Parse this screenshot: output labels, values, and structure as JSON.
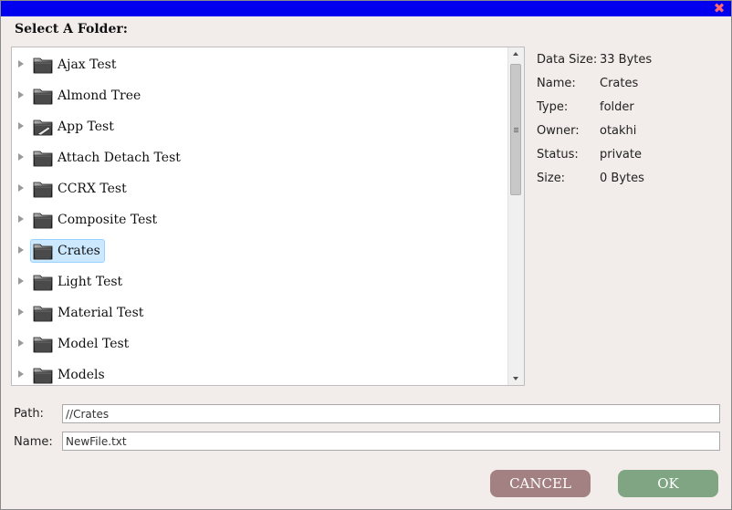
{
  "dialog": {
    "close_glyph": "✖",
    "heading": "Select A Folder:"
  },
  "tree": {
    "items": [
      {
        "label": "Ajax Test",
        "icon": "folder-icon",
        "selected": false
      },
      {
        "label": "Almond Tree",
        "icon": "folder-icon",
        "selected": false
      },
      {
        "label": "App Test",
        "icon": "app-folder-icon",
        "selected": false
      },
      {
        "label": "Attach Detach Test",
        "icon": "folder-icon",
        "selected": false
      },
      {
        "label": "CCRX Test",
        "icon": "folder-icon",
        "selected": false
      },
      {
        "label": "Composite Test",
        "icon": "folder-icon",
        "selected": false
      },
      {
        "label": "Crates",
        "icon": "folder-icon",
        "selected": true
      },
      {
        "label": "Light Test",
        "icon": "folder-icon",
        "selected": false
      },
      {
        "label": "Material Test",
        "icon": "folder-icon",
        "selected": false
      },
      {
        "label": "Model Test",
        "icon": "folder-icon",
        "selected": false
      },
      {
        "label": "Models",
        "icon": "folder-icon",
        "selected": false
      }
    ]
  },
  "info": [
    {
      "key": "Data Size:",
      "value": "33 Bytes"
    },
    {
      "key": "Name:",
      "value": "Crates"
    },
    {
      "key": "Type:",
      "value": "folder"
    },
    {
      "key": "Owner:",
      "value": "otakhi"
    },
    {
      "key": "Status:",
      "value": "private"
    },
    {
      "key": "Size:",
      "value": "0 Bytes"
    }
  ],
  "path_field": {
    "label": "Path:",
    "value": "//Crates"
  },
  "name_field": {
    "label": "Name:",
    "value": "NewFile.txt"
  },
  "buttons": {
    "cancel": "CANCEL",
    "ok": "OK"
  },
  "colors": {
    "titlebar": "#0000ee",
    "cancel": "#a38082",
    "ok": "#7fa582",
    "selection": "#cce8ff"
  }
}
